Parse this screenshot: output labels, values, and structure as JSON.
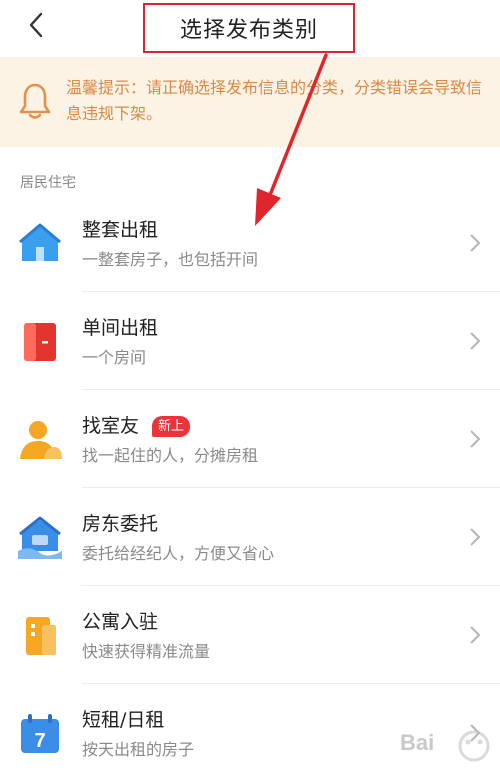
{
  "header": {
    "title": "选择发布类别",
    "back_icon": "chevron-left-icon"
  },
  "notice": {
    "icon": "bell-icon",
    "text": "温馨提示：请正确选择发布信息的分类，分类错误会导致信息违规下架。"
  },
  "section": {
    "label": "居民住宅"
  },
  "items": [
    {
      "name": "整套出租",
      "desc": "一整套房子，也包括开间",
      "icon": "house-icon",
      "color": "#3aa0ee"
    },
    {
      "name": "单间出租",
      "desc": "一个房间",
      "icon": "door-icon",
      "color": "#e2352f"
    },
    {
      "name": "找室友",
      "desc": "找一起住的人，分摊房租",
      "icon": "roommate-icon",
      "color": "#f5a623",
      "badge": "新上"
    },
    {
      "name": "房东委托",
      "desc": "委托给经纪人，方便又省心",
      "icon": "landlord-house-icon",
      "color": "#3a8ee8"
    },
    {
      "name": "公寓入驻",
      "desc": "快速获得精准流量",
      "icon": "apartment-icon",
      "color": "#f5a623"
    },
    {
      "name": "短租/日租",
      "desc": "按天出租的房子",
      "icon": "calendar-icon",
      "color": "#3a8ee8",
      "calendar_number": "7"
    }
  ],
  "annotation": {
    "arrow_color": "#e0262c",
    "box_color": "#d8262e"
  },
  "watermark": {
    "text": "Bai"
  }
}
